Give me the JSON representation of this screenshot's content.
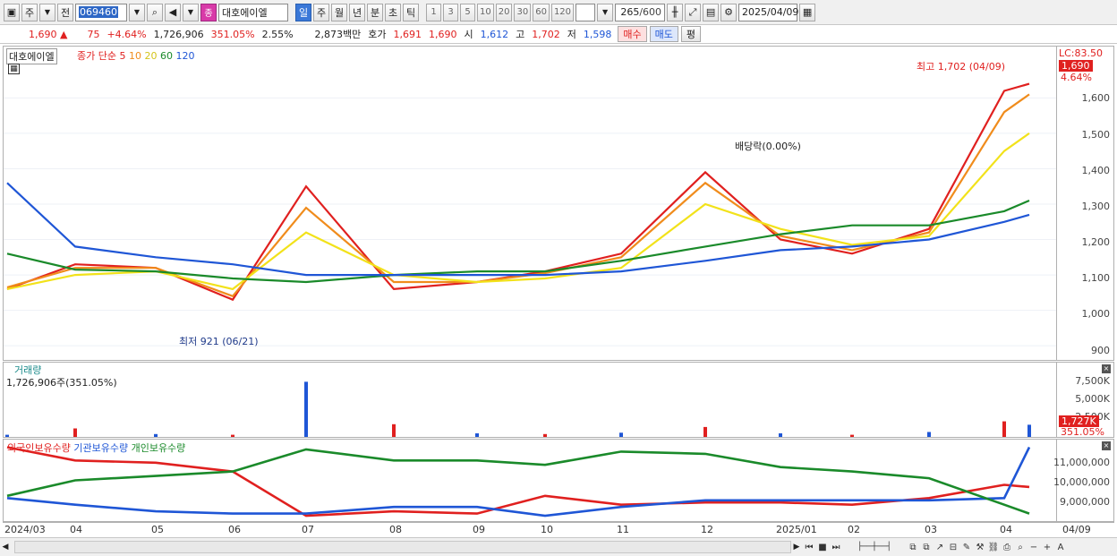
{
  "toolbar": {
    "market": "주",
    "prev": "전",
    "code": "069460",
    "name": "대호에이엘",
    "intervals": [
      "일",
      "주",
      "월",
      "년",
      "분",
      "초",
      "틱"
    ],
    "active_interval": "일",
    "minutes": [
      "1",
      "3",
      "5",
      "10",
      "20",
      "30",
      "60",
      "120"
    ],
    "count": "265",
    "total": "/600",
    "date": "2025/04/09",
    "jong_badge": "종"
  },
  "quote": {
    "price": "1,690",
    "arrow": "▲",
    "change": "75",
    "rate": "+4.64%",
    "volume": "1,726,906",
    "volume_rate": "351.05%",
    "turnover": "2.55%",
    "amount": "2,873백만",
    "hoga_label": "호가",
    "ask": "1,691",
    "bid": "1,690",
    "open_label": "시",
    "open": "1,612",
    "high_label": "고",
    "high": "1,702",
    "low_label": "저",
    "low": "1,598",
    "buy": "매수",
    "sell": "매도",
    "avg": "평"
  },
  "price_pane": {
    "name": "대호에이엘",
    "ma_title": "종가 단순",
    "ma_periods": [
      "5",
      "10",
      "20",
      "60",
      "120"
    ],
    "ma_colors": [
      "#e0201f",
      "#f08c1c",
      "#f2e21a",
      "#1a8a2a",
      "#1f56d6"
    ],
    "lc": "LC:83.50",
    "last_price": "1,690",
    "last_rate": "4.64%",
    "yticks": [
      "1,600",
      "1,500",
      "1,400",
      "1,300",
      "1,200",
      "1,100",
      "1,000",
      "900"
    ],
    "high_note": "최고 1,702 (04/09)",
    "low_note": "최저 921 (06/21)",
    "dividend_note": "배당락(0.00%)"
  },
  "volume_pane": {
    "title": "거래량",
    "value": "1,726,906주(351.05%)",
    "yticks": [
      "7,500K",
      "5,000K",
      "2,500K"
    ],
    "last_tag": "1,727K",
    "last_rate": "351.05%"
  },
  "holdings_pane": {
    "series": [
      "외국인보유수량",
      "기관보유수량",
      "개인보유수량"
    ],
    "colors": [
      "#e0201f",
      "#1f56d6",
      "#1a8a2a"
    ],
    "yticks": [
      "11,000,000",
      "10,000,000",
      "9,000,000"
    ]
  },
  "x_axis": {
    "labels": [
      "2024/03",
      "04",
      "05",
      "06",
      "07",
      "08",
      "09",
      "10",
      "11",
      "12",
      "2025/01",
      "02",
      "03",
      "04"
    ],
    "right_label": "04/09"
  },
  "chart_data": [
    {
      "type": "line",
      "title": "대호에이엘",
      "x": [
        "2024/03",
        "04",
        "05",
        "06",
        "07",
        "08",
        "09",
        "10",
        "11",
        "12",
        "2025/01",
        "02",
        "03",
        "04",
        "04/09"
      ],
      "ylim": [
        870,
        1730
      ],
      "series": [
        {
          "name": "5",
          "values": [
            1060,
            1130,
            1120,
            1030,
            1350,
            1060,
            1080,
            1110,
            1160,
            1390,
            1200,
            1160,
            1230,
            1620,
            1640
          ]
        },
        {
          "name": "10",
          "values": [
            1065,
            1120,
            1120,
            1040,
            1290,
            1080,
            1080,
            1105,
            1150,
            1360,
            1210,
            1170,
            1220,
            1560,
            1610
          ]
        },
        {
          "name": "20",
          "values": [
            1060,
            1100,
            1110,
            1060,
            1220,
            1100,
            1080,
            1090,
            1120,
            1300,
            1230,
            1185,
            1210,
            1450,
            1500
          ]
        },
        {
          "name": "60",
          "values": [
            1160,
            1115,
            1110,
            1090,
            1080,
            1100,
            1110,
            1110,
            1140,
            1180,
            1215,
            1240,
            1240,
            1280,
            1310
          ]
        },
        {
          "name": "120",
          "values": [
            1360,
            1180,
            1150,
            1130,
            1100,
            1100,
            1100,
            1100,
            1110,
            1140,
            1170,
            1180,
            1200,
            1250,
            1270
          ]
        }
      ]
    },
    {
      "type": "bar",
      "title": "거래량",
      "categories": [
        "2024/03",
        "04",
        "05",
        "06",
        "07",
        "08",
        "09",
        "10",
        "11",
        "12",
        "2025/01",
        "02",
        "03",
        "04",
        "04/09"
      ],
      "ylim": [
        0,
        10000
      ],
      "series": [
        {
          "name": "거래량",
          "values": [
            300,
            1200,
            400,
            300,
            7800,
            1800,
            500,
            400,
            600,
            1400,
            500,
            300,
            700,
            2200,
            1727
          ]
        }
      ]
    },
    {
      "type": "line",
      "title": "보유수량",
      "x": [
        "2024/03",
        "04",
        "05",
        "06",
        "07",
        "08",
        "09",
        "10",
        "11",
        "12",
        "2025/01",
        "02",
        "03",
        "04",
        "04/09"
      ],
      "ylim": [
        8300000,
        11700000
      ],
      "series": [
        {
          "name": "외국인보유수량",
          "values": [
            11600000,
            11000000,
            10900000,
            10500000,
            8500000,
            8700000,
            8600000,
            9400000,
            9000000,
            9100000,
            9100000,
            9000000,
            9300000,
            9900000,
            9800000
          ]
        },
        {
          "name": "기관보유수량",
          "values": [
            9300000,
            9000000,
            8700000,
            8600000,
            8600000,
            8900000,
            8900000,
            8500000,
            8900000,
            9200000,
            9200000,
            9200000,
            9200000,
            9300000,
            11600000
          ]
        },
        {
          "name": "개인보유수량",
          "values": [
            9400000,
            10100000,
            10300000,
            10500000,
            11500000,
            11000000,
            11000000,
            10800000,
            11400000,
            11300000,
            10700000,
            10500000,
            10200000,
            9000000,
            8600000
          ]
        }
      ]
    }
  ]
}
